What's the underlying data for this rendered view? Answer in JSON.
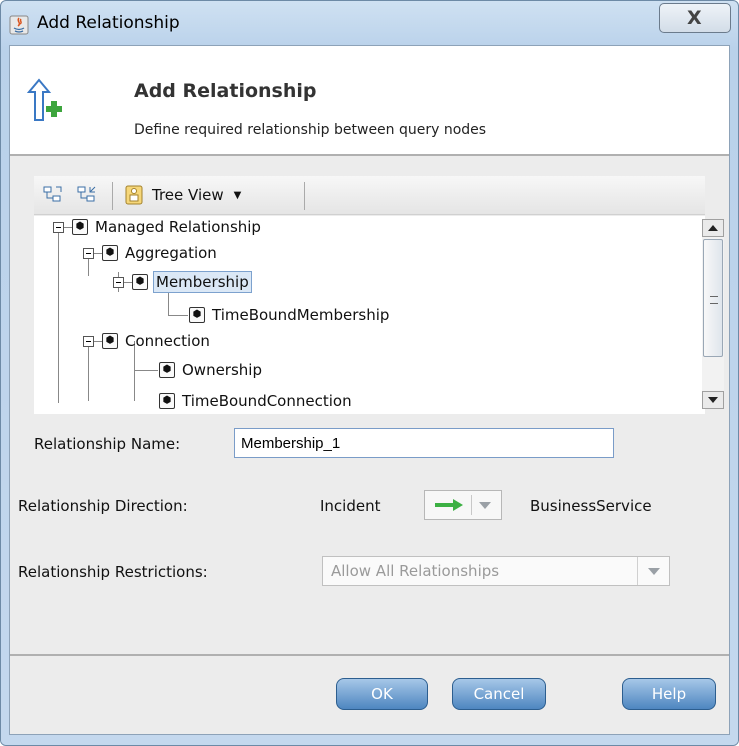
{
  "window": {
    "title": "Add Relationship",
    "close_glyph": "X"
  },
  "header": {
    "title": "Add Relationship",
    "subtitle": "Define required relationship between query nodes",
    "icon": "arrow-up-plus-icon"
  },
  "toolbar": {
    "tree_view_label": "Tree View",
    "icons": [
      "expand-all-icon",
      "collapse-all-icon",
      "tree-view-icon",
      "dropdown-arrow-icon"
    ]
  },
  "tree": {
    "nodes": [
      {
        "label": "Managed Relationship",
        "level": 0,
        "expandable": true,
        "selected": false
      },
      {
        "label": "Aggregation",
        "level": 1,
        "expandable": true,
        "selected": false
      },
      {
        "label": "Membership",
        "level": 2,
        "expandable": true,
        "selected": true
      },
      {
        "label": "TimeBoundMembership",
        "level": 3,
        "expandable": false,
        "selected": false
      },
      {
        "label": "Connection",
        "level": 1,
        "expandable": true,
        "selected": false
      },
      {
        "label": "Ownership",
        "level": 2,
        "expandable": false,
        "selected": false
      }
    ],
    "partial_node": "TimeBoundConnection"
  },
  "form": {
    "name_label": "Relationship Name:",
    "name_value": "Membership_1",
    "direction_label": "Relationship Direction:",
    "direction_source": "Incident",
    "direction_target": "BusinessService",
    "restrictions_label": "Relationship Restrictions:",
    "restrictions_value": "Allow All Relationships"
  },
  "buttons": {
    "ok": "OK",
    "cancel": "Cancel",
    "help": "Help"
  },
  "colors": {
    "button_blue": "#4e86c0",
    "arrow_green": "#3cb043",
    "selection": "#dbe8f6"
  }
}
